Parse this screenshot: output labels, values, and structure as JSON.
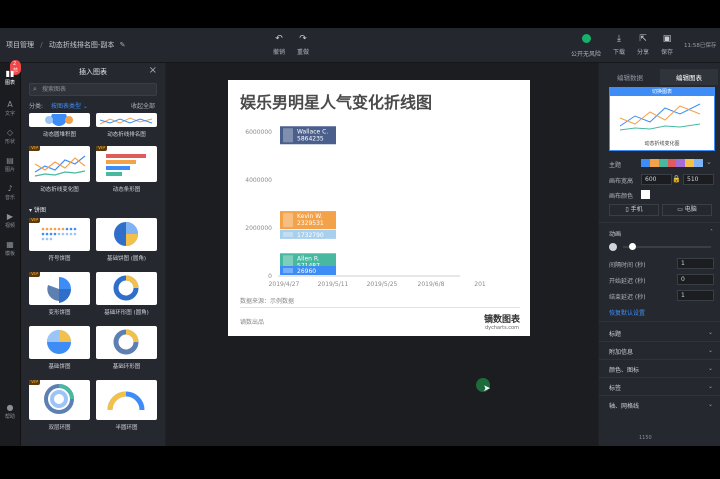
{
  "topbar": {
    "crumb_root": "项目管理",
    "crumb_sep": "/",
    "crumb_current": "动态折线排名图-副本",
    "undo": "撤销",
    "redo": "重做",
    "risk": "公开无风险",
    "download": "下载",
    "share": "分享",
    "save": "保存",
    "autosave": "11:58已保存"
  },
  "sidebar": {
    "badge": "2节",
    "items": [
      "图表",
      "文字",
      "形状",
      "图片",
      "音乐",
      "视频",
      "模板"
    ],
    "help": "帮助"
  },
  "panel": {
    "title": "插入图表",
    "search_placeholder": "搜索图表",
    "filter_label": "分类:",
    "filter_value": "按图表类型",
    "collapse_all": "收起全部",
    "vip": "VIP",
    "pie_section": "饼图",
    "cards": [
      "动态圆堆积图",
      "动态折线排名图",
      "动态折线变化图",
      "动态条形图",
      "符号饼图",
      "基础饼图 (圆角)",
      "变形饼图",
      "基础环形图 (圆角)",
      "基础饼图",
      "基础环形图",
      "双层环图",
      "半圆环图"
    ]
  },
  "chart": {
    "title": "娱乐男明星人气变化折线图",
    "source": "数据来源：示例数据",
    "footer_left": "镝数出品",
    "brand": "镝数图表",
    "brand_url": "dycharts.com"
  },
  "chart_data": {
    "type": "line",
    "title": "娱乐男明星人气变化折线图",
    "y_ticks": [
      "6000000",
      "4000000",
      "2000000",
      "0"
    ],
    "x_ticks": [
      "2019/4/27",
      "2019/5/11",
      "2019/5/25",
      "2019/6/8",
      "201"
    ],
    "ylim": [
      0,
      6500000
    ],
    "series": [
      {
        "name": "Wallace C.",
        "values": [
          5864235
        ],
        "color": "#4a5f8c"
      },
      {
        "name": "Kevin W.",
        "values": [
          2329531
        ],
        "color": "#f3a24a"
      },
      {
        "name": "",
        "values": [
          1732790
        ],
        "color": "#a9cfee"
      },
      {
        "name": "Allen R.",
        "values": [
          571487
        ],
        "color": "#48b8a0"
      },
      {
        "name": "",
        "values": [
          26960
        ],
        "color": "#3e8df7"
      }
    ]
  },
  "right": {
    "tab_data": "编辑数据",
    "tab_chart": "编辑图表",
    "preview_header": "切换图表",
    "preview_caption": "动态折线变化图",
    "theme": "主题",
    "size": "画布宽高",
    "width": "600",
    "height": "510",
    "bg": "画布颜色",
    "phone": "手机",
    "pc": "电脑",
    "anim": "动画",
    "interval": "间隔时间 (秒)",
    "interval_v": "1",
    "start": "开始延迟 (秒)",
    "start_v": "0",
    "end": "结束延迟 (秒)",
    "end_v": "1",
    "reset": "恢复默认设置",
    "sections": [
      "标题",
      "附加信息",
      "颜色、图标",
      "标签",
      "轴、网格线"
    ],
    "chev": "⌄",
    "zoom": "1150"
  },
  "colors": {
    "accent": "#3e8df7",
    "canvas": "#1b1d21"
  }
}
